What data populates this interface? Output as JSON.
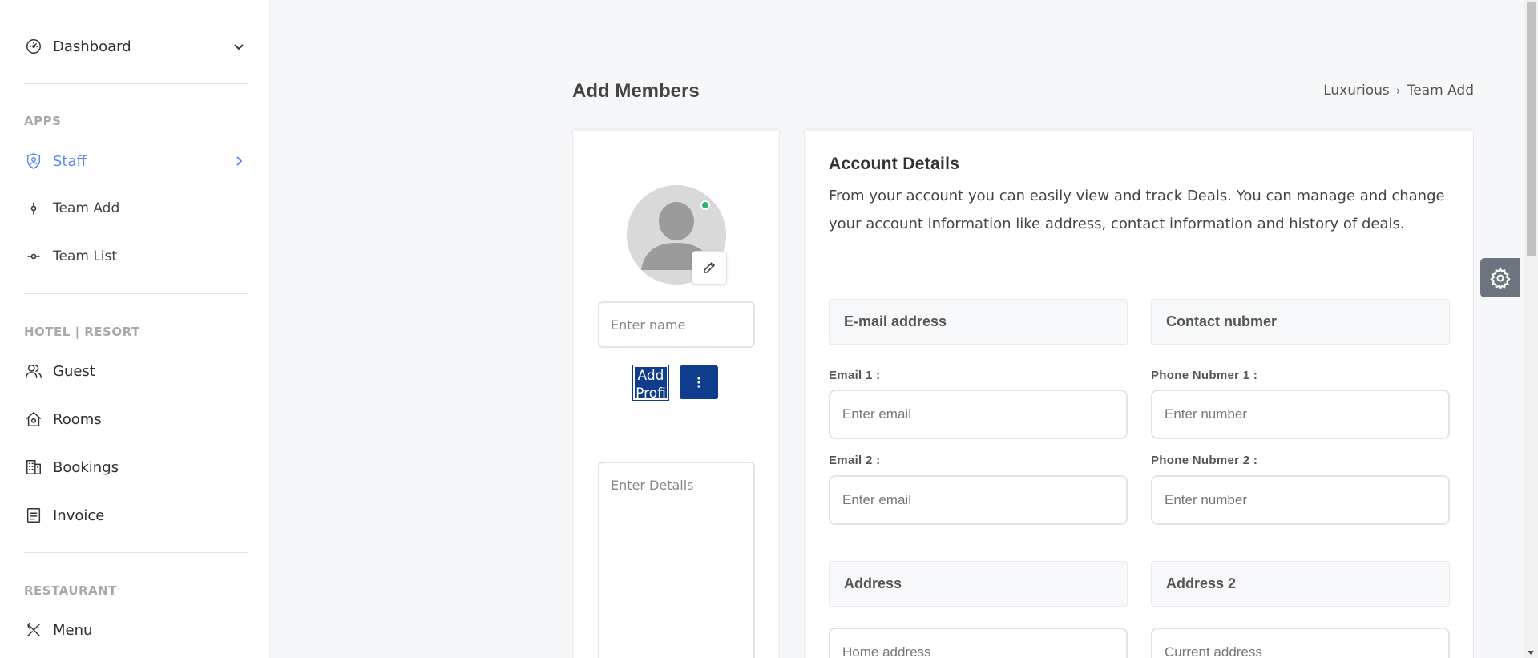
{
  "sidebar": {
    "dashboard": {
      "label": "Dashboard",
      "icon": "gauge-icon"
    },
    "sections": [
      {
        "title": "APPS"
      },
      {
        "title": "HOTEL | RESORT"
      },
      {
        "title": "RESTAURANT"
      }
    ],
    "staff": {
      "label": "Staff",
      "icon": "badge-icon"
    },
    "team_add": {
      "label": "Team Add"
    },
    "team_list": {
      "label": "Team List"
    },
    "guest": {
      "label": "Guest"
    },
    "rooms": {
      "label": "Rooms"
    },
    "bookings": {
      "label": "Bookings"
    },
    "invoice": {
      "label": "Invoice"
    },
    "menu": {
      "label": "Menu"
    }
  },
  "header": {
    "title": "Add Members",
    "breadcrumb": [
      "Luxurious",
      "Team Add"
    ]
  },
  "profile": {
    "name_placeholder": "Enter name",
    "add_profile_label": "Add Profile",
    "details_placeholder": "Enter Details",
    "status_color": "#2bb673"
  },
  "account": {
    "title": "Account Details",
    "description": "From your account you can easily view and track Deals. You can manage and change your account information like address, contact information and history of deals.",
    "email_section": "E-mail address",
    "contact_section": "Contact nubmer",
    "email1_label": "Email 1 :",
    "email1_placeholder": "Enter email",
    "phone1_label": "Phone Nubmer 1 :",
    "phone1_placeholder": "Enter number",
    "email2_label": "Email 2 :",
    "email2_placeholder": "Enter email",
    "phone2_label": "Phone Nubmer 2 :",
    "phone2_placeholder": "Enter number",
    "address_section": "Address",
    "address2_section": "Address 2",
    "home_placeholder": "Home address",
    "current_placeholder": "Current address"
  },
  "colors": {
    "accent": "#5b8def",
    "primary_button": "#0f3c8c"
  }
}
